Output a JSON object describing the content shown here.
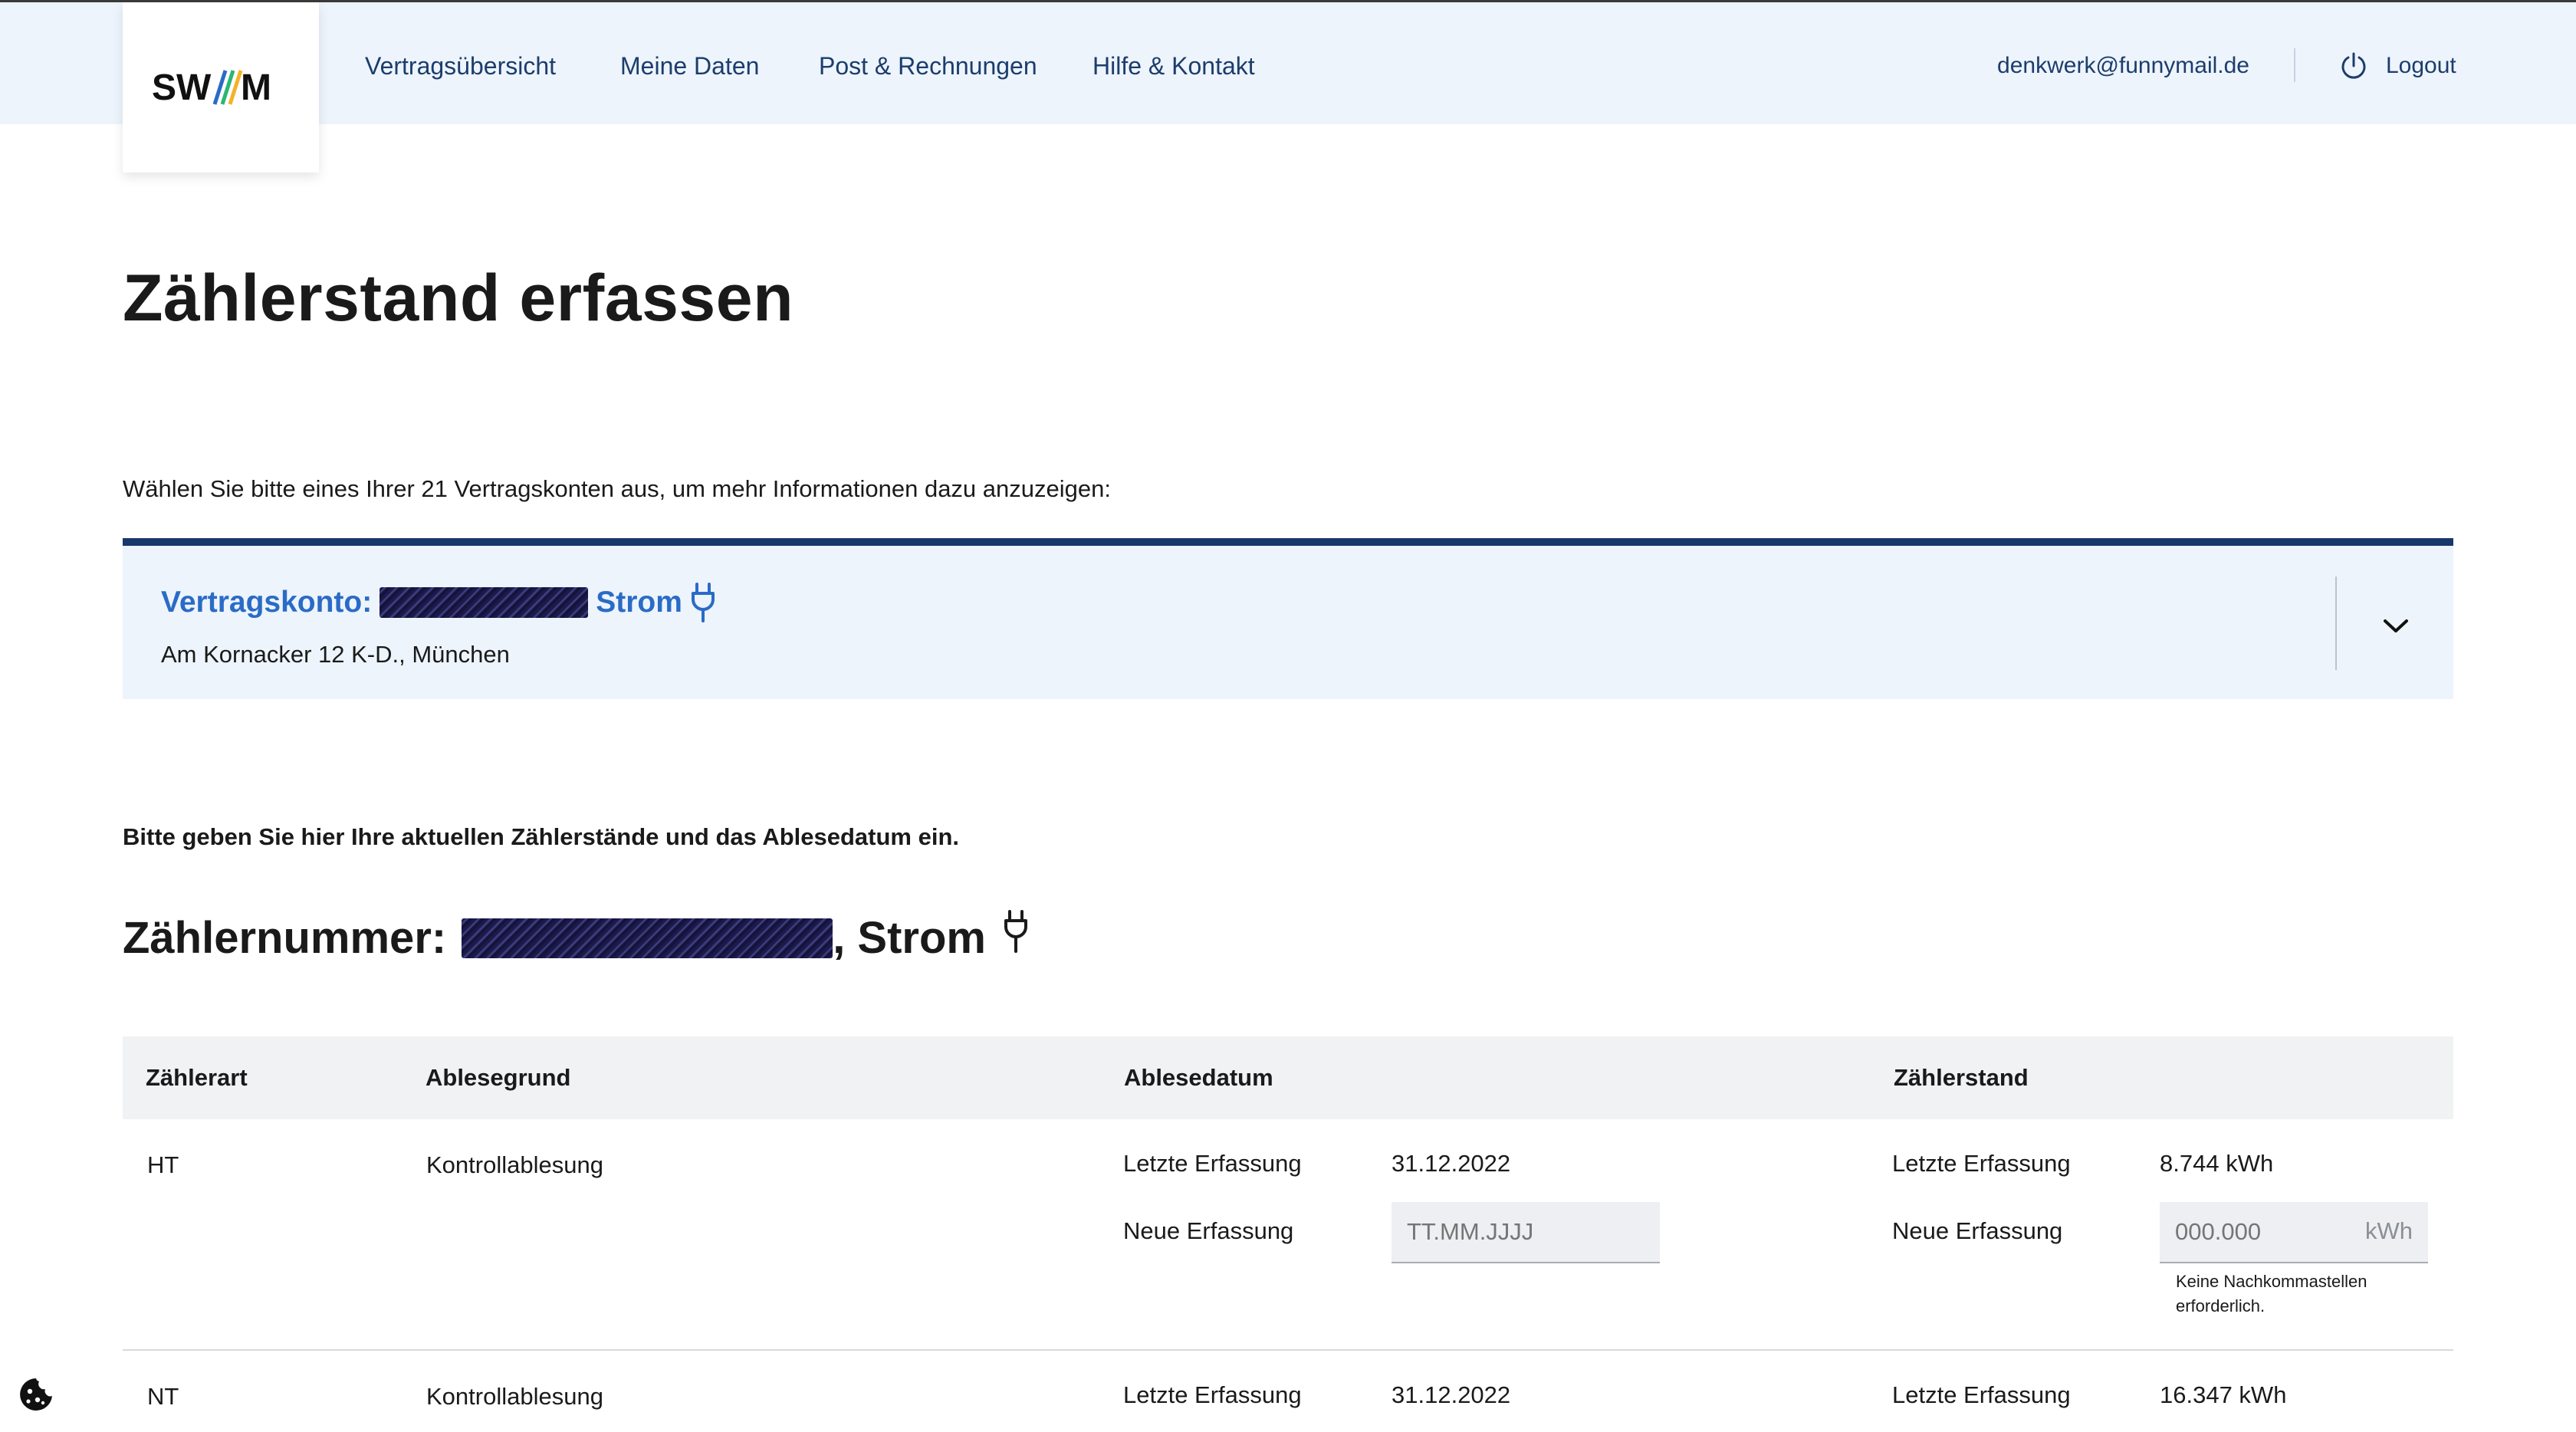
{
  "header": {
    "logo_text": "SWM",
    "nav": [
      {
        "label": "Vertragsübersicht"
      },
      {
        "label": "Meine Daten"
      },
      {
        "label": "Post & Rechnungen"
      },
      {
        "label": "Hilfe & Kontakt"
      }
    ],
    "user_email": "denkwerk@funnymail.de",
    "logout_label": "Logout",
    "logout_icon": "power-icon"
  },
  "page": {
    "title": "Zählerstand erfassen",
    "intro": "Wählen Sie bitte eines Ihrer 21 Vertragskonten aus, um mehr Informationen dazu anzuzeigen:",
    "instruction": "Bitte geben Sie hier Ihre aktuellen Zählerstände und das Ablesedatum ein."
  },
  "account": {
    "label": "Vertragskonto:",
    "type": "Strom",
    "address": "Am Kornacker 12 K-D., München",
    "icon": "plug-icon",
    "expand_icon": "chevron-down-icon"
  },
  "meter": {
    "label": "Zählernummer:",
    "type": ", Strom",
    "icon": "plug-icon"
  },
  "table": {
    "headers": {
      "type": "Zählerart",
      "reason": "Ablesegrund",
      "date": "Ablesedatum",
      "reading": "Zählerstand"
    },
    "rows": [
      {
        "meter_type": "HT",
        "reason": "Kontrollablesung",
        "last_label": "Letzte Erfassung",
        "last_date": "31.12.2022",
        "new_label": "Neue Erfassung",
        "date_placeholder": "TT.MM.JJJJ",
        "last_reading_label": "Letzte Erfassung",
        "last_reading": "8.744 kWh",
        "new_reading_label": "Neue Erfassung",
        "reading_placeholder": "000.000",
        "unit": "kWh",
        "hint": "Keine Nachkommastellen erforderlich."
      },
      {
        "meter_type": "NT",
        "reason": "Kontrollablesung",
        "last_label": "Letzte Erfassung",
        "last_date": "31.12.2022",
        "last_reading_label": "Letzte Erfassung",
        "last_reading": "16.347 kWh"
      }
    ]
  },
  "cookie_icon": "cookie-icon"
}
